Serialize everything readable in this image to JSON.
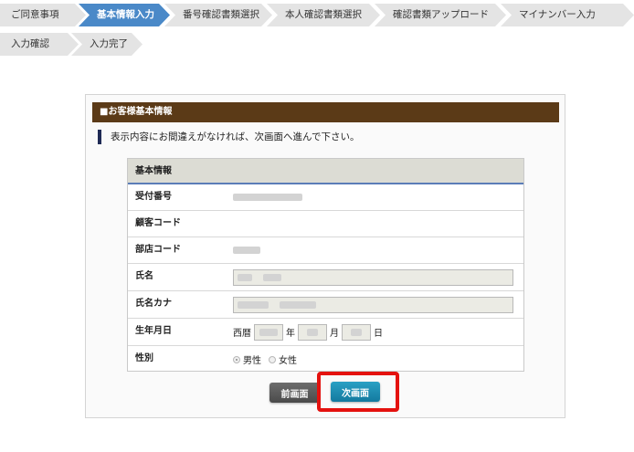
{
  "steps": [
    {
      "label": "ご同意事項"
    },
    {
      "label": "基本情報入力"
    },
    {
      "label": "番号確認書類選択"
    },
    {
      "label": "本人確認書類選択"
    },
    {
      "label": "確認書類アップロード"
    },
    {
      "label": "マイナンバー入力"
    },
    {
      "label": "入力確認"
    },
    {
      "label": "入力完了"
    }
  ],
  "active_step": "基本情報入力",
  "panel": {
    "title": "■お客様基本情報",
    "notice": "表示内容にお間違えがなければ、次画面へ進んで下さい。"
  },
  "info": {
    "header": "基本情報",
    "rows": {
      "reception_no": {
        "label": "受付番号"
      },
      "customer_code": {
        "label": "顧客コード"
      },
      "branch_code": {
        "label": "部店コード"
      },
      "name": {
        "label": "氏名"
      },
      "name_kana": {
        "label": "氏名カナ"
      },
      "birth": {
        "label": "生年月日",
        "era": "西暦",
        "year_unit": "年",
        "month_unit": "月",
        "day_unit": "日"
      },
      "gender": {
        "label": "性別",
        "options": [
          "男性",
          "女性"
        ],
        "selected": "男性"
      }
    }
  },
  "buttons": {
    "prev": "前画面",
    "next": "次画面"
  },
  "colors": {
    "header_brown": "#5b3a17",
    "step_active": "#4a89c8",
    "next_button": "#1a8db3",
    "highlight": "#e4120f"
  }
}
